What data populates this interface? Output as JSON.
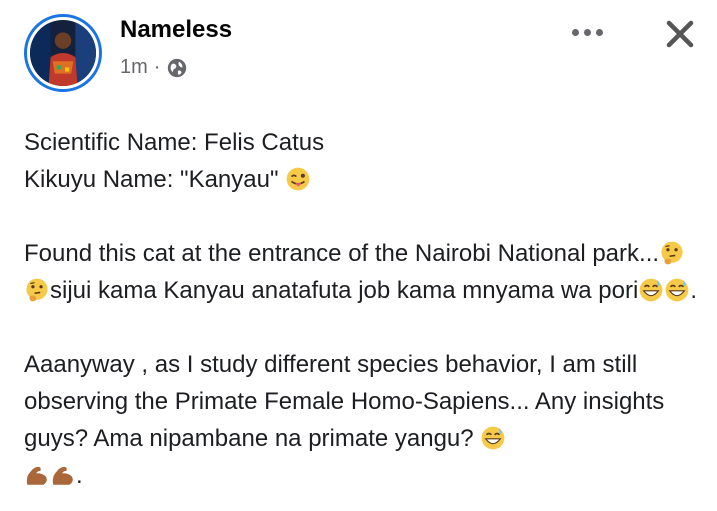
{
  "post": {
    "author": "Nameless",
    "time": "1m",
    "separator": "·",
    "audience_icon": "globe-icon",
    "menu_icon": "more-options-icon",
    "close_icon": "close-icon",
    "text": {
      "line1": "Scientific Name: Felis Catus",
      "line2_prefix": "Kikuyu Name: \"Kanyau\"",
      "para2_a": "Found this cat at the entrance of the Nairobi National park...",
      "para2_b": "sijui kama Kanyau anatafuta job kama mnyama wa pori",
      "para2_end": ".",
      "para3": "Aaanyway , as I study different species behavior, I am still observing the Primate Female Homo-Sapiens... Any insights guys? Ama nipambane na primate yangu?",
      "para3_end": "."
    },
    "emojis": [
      "winking-tongue-emoji",
      "thinking-face-emoji",
      "grinning-sweat-emoji",
      "flexed-biceps-emoji"
    ]
  }
}
